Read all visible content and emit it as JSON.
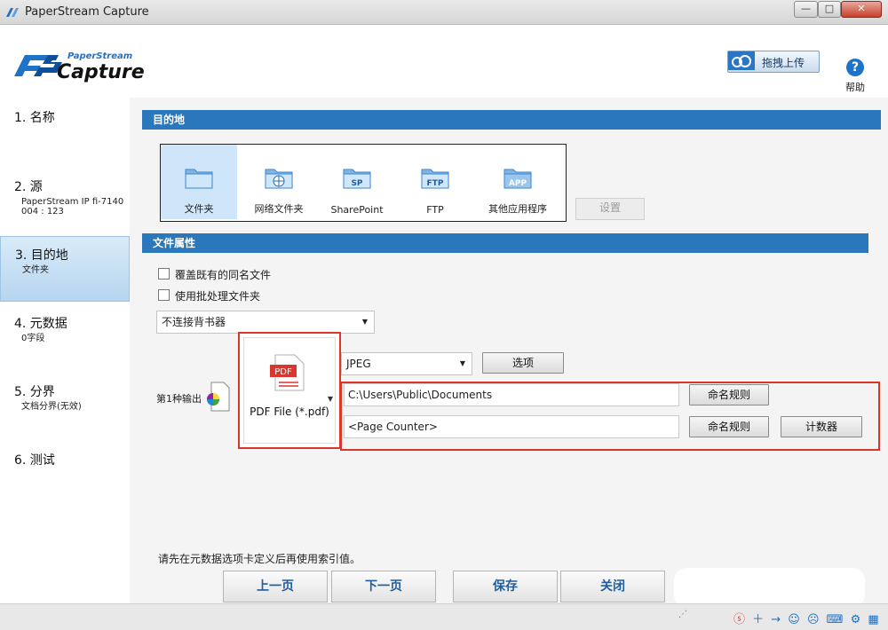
{
  "window": {
    "title": "PaperStream Capture"
  },
  "header": {
    "logo_top": "PaperStream",
    "logo_main": "Capture",
    "upload_label": "拖拽上传",
    "help_label": "帮助"
  },
  "sidebar": {
    "steps": [
      {
        "label": "1. 名称",
        "sub": ""
      },
      {
        "label": "2. 源",
        "sub": "PaperStream IP fi-7140",
        "sub2": "004 : 123"
      },
      {
        "label": "3. 目的地",
        "sub": "文件夹"
      },
      {
        "label": "4. 元数据",
        "sub": "0字段"
      },
      {
        "label": "5. 分界",
        "sub": "文档分界(无效)"
      },
      {
        "label": "6. 测试",
        "sub": ""
      }
    ]
  },
  "destination": {
    "section_title": "目的地",
    "options": [
      {
        "label": "文件夹",
        "icon": "folder-icon",
        "badge": ""
      },
      {
        "label": "网络文件夹",
        "icon": "network-folder-icon",
        "badge": ""
      },
      {
        "label": "SharePoint",
        "icon": "sharepoint-folder-icon",
        "badge": "SP"
      },
      {
        "label": "FTP",
        "icon": "ftp-folder-icon",
        "badge": "FTP"
      },
      {
        "label": "其他应用程序",
        "icon": "app-folder-icon",
        "badge": "APP"
      }
    ],
    "settings_label": "设置"
  },
  "file_properties": {
    "section_title": "文件属性",
    "overwrite_label": "覆盖既有的同名文件",
    "batch_folder_label": "使用批处理文件夹",
    "binder_dropdown": "不连接背书器",
    "output_label": "第1种输出",
    "pdf_badge": "PDF",
    "pdf_format": "PDF File (*.pdf)",
    "jpeg_dropdown": "JPEG",
    "options_label": "选项",
    "path_value": "C:\\Users\\Public\\Documents",
    "name_value": "<Page Counter>",
    "naming_rule_label": "命名规则",
    "counter_label": "计数器",
    "note": "请先在元数据选项卡定义后再使用索引值。"
  },
  "nav": {
    "prev": "上一页",
    "next": "下一页",
    "save": "保存",
    "close": "关闭"
  },
  "colors": {
    "section_blue": "#2a78bb",
    "highlight_red": "#d9372e",
    "selected_bg": "#cfe5fa"
  }
}
